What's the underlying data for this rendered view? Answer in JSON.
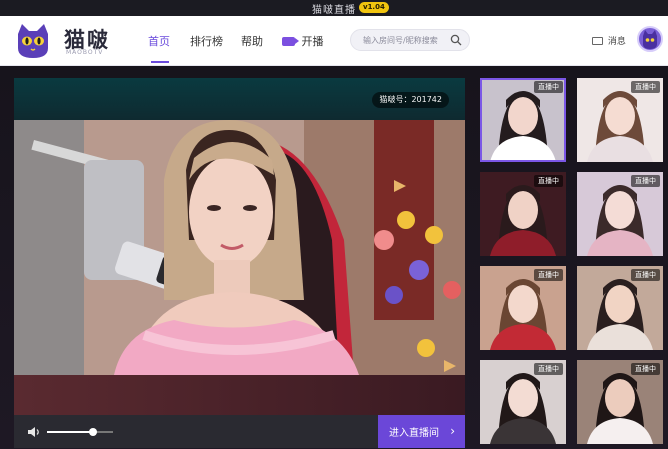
{
  "window": {
    "title": "猫啵直播",
    "version": "v1.04"
  },
  "brand": {
    "name": "猫啵",
    "sub": "MAOBOTV"
  },
  "nav": {
    "items": [
      {
        "label": "首页",
        "active": true
      },
      {
        "label": "排行榜",
        "active": false
      },
      {
        "label": "帮助",
        "active": false
      },
      {
        "label": "开播",
        "active": false
      }
    ]
  },
  "search": {
    "placeholder": "输入房间号/昵称搜索",
    "value": ""
  },
  "user": {
    "messages_label": "消息"
  },
  "player": {
    "room_id_label": "猫啵号：201742",
    "volume": 0.7,
    "enter_label": "进入直播间",
    "enter_chevron": "›"
  },
  "thumbnails": {
    "badge": "直播中",
    "items": [
      {
        "selected": true,
        "bg": "#c8c2cc",
        "skin": "#f2d6cc",
        "hair": "#241c1e",
        "outfit": "#ffffff"
      },
      {
        "selected": false,
        "bg": "#efe7e6",
        "skin": "#f5dcd2",
        "hair": "#6d4a3a",
        "outfit": "#e9dfe2"
      },
      {
        "selected": false,
        "bg": "#3e1b22",
        "skin": "#f0d2c6",
        "hair": "#2a1a1c",
        "outfit": "#8f1d2a"
      },
      {
        "selected": false,
        "bg": "#d7c9d8",
        "skin": "#f4dcd6",
        "hair": "#3b2a2a",
        "outfit": "#e5b4c4"
      },
      {
        "selected": false,
        "bg": "#c9a28f",
        "skin": "#f3d8cc",
        "hair": "#6a4633",
        "outfit": "#c22a35"
      },
      {
        "selected": false,
        "bg": "#c2a99a",
        "skin": "#f1d4c4",
        "hair": "#2a1f1f",
        "outfit": "#eae0da"
      },
      {
        "selected": false,
        "bg": "#d8d0d0",
        "skin": "#f3dcd3",
        "hair": "#211818",
        "outfit": "#3a3436"
      },
      {
        "selected": false,
        "bg": "#9a8378",
        "skin": "#ecccbd",
        "hair": "#1f1616",
        "outfit": "#f5efef"
      }
    ]
  },
  "colors": {
    "accent": "#6b47d8",
    "nav_active": "#6a4bdc",
    "version_badge": "#f1c40f"
  },
  "icons": [
    "cat-logo-icon",
    "search-icon",
    "mail-icon",
    "live-camera-icon",
    "volume-icon"
  ]
}
